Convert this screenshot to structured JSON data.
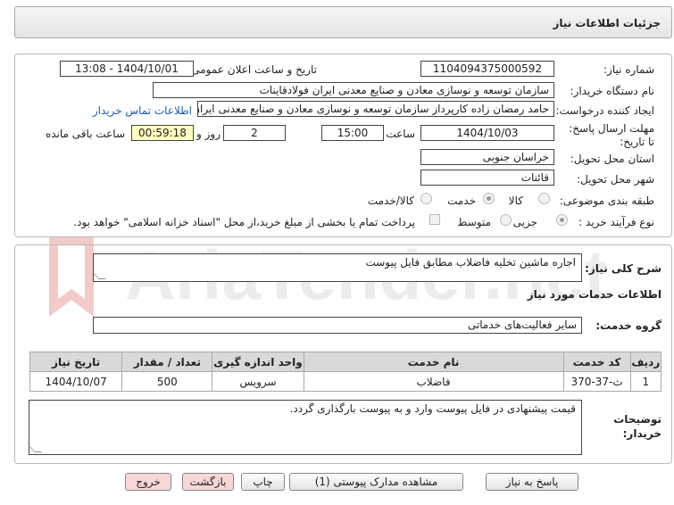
{
  "header": {
    "title": "جزئیات اطلاعات نیاز"
  },
  "form": {
    "need_number_label": "شماره نیاز:",
    "need_number": "1104094375000592",
    "announce_label": "تاریخ و ساعت اعلان عمومی:",
    "announce_value": "1404/10/01 - 13:08",
    "buyer_org_label": "نام دستگاه خریدار:",
    "buyer_org": "سازمان توسعه و نوسازی معادن و صنایع معدنی ایران فولادقاینات",
    "requester_label": "ایجاد کننده درخواست:",
    "requester": "حامد  رمضان زاده  کارپرداز  سازمان توسعه و نوسازی معادن و صنایع معدنی ایران",
    "contact_link": "اطلاعات تماس خریدار",
    "deadline_label": "مهلت ارسال پاسخ: تا تاریخ:",
    "deadline_date": "1404/10/03",
    "time_label": "ساعت",
    "deadline_time": "15:00",
    "days_value": "2",
    "days_label": "روز و",
    "remaining_time": "00:59:18",
    "remaining_label": "ساعت باقی مانده",
    "province_label": "استان محل تحویل:",
    "province": "خراسان جنوبی",
    "city_label": "شهر محل تحویل:",
    "city": "قائنات",
    "category_label": "طبقه بندی موضوعی:",
    "category_options": [
      "کالا",
      "خدمت",
      "کالا/خدمت"
    ],
    "process_label": "نوع فرآیند خرید :",
    "process_options": [
      "جزیی",
      "متوسط"
    ],
    "payment_note": "پرداخت تمام یا بخشی از مبلغ خرید،از محل \"اسناد خزانه اسلامی\" خواهد بود."
  },
  "description": {
    "label": "شرح کلی نیاز:",
    "value": "اجاره ماشین تخلیه فاضلاب مطابق فایل پیوست"
  },
  "services": {
    "section_title": "اطلاعات خدمات مورد نیاز",
    "group_label": "گروه خدمت:",
    "group_value": "سایر فعالیت‌های خدماتی",
    "columns": [
      "ردیف",
      "کد خدمت",
      "نام خدمت",
      "واحد اندازه گیری",
      "تعداد / مقدار",
      "تاریخ نیاز"
    ],
    "rows": [
      [
        "1",
        "ث-37-370",
        "فاضلاب",
        "سرویس",
        "500",
        "1404/10/07"
      ]
    ]
  },
  "buyer_notes": {
    "label": "توضیحات خریدار:",
    "value": "قیمت پیشنهادی در فایل پیوست وارد و به پیوست بارگذاری گردد."
  },
  "buttons": {
    "reply": "پاسخ به نیاز",
    "attachments": "مشاهده مدارک پیوستی (1)",
    "print": "چاپ",
    "back": "بازگشت",
    "exit": "خروج"
  },
  "watermark": {
    "text": "AriaTender.net"
  }
}
